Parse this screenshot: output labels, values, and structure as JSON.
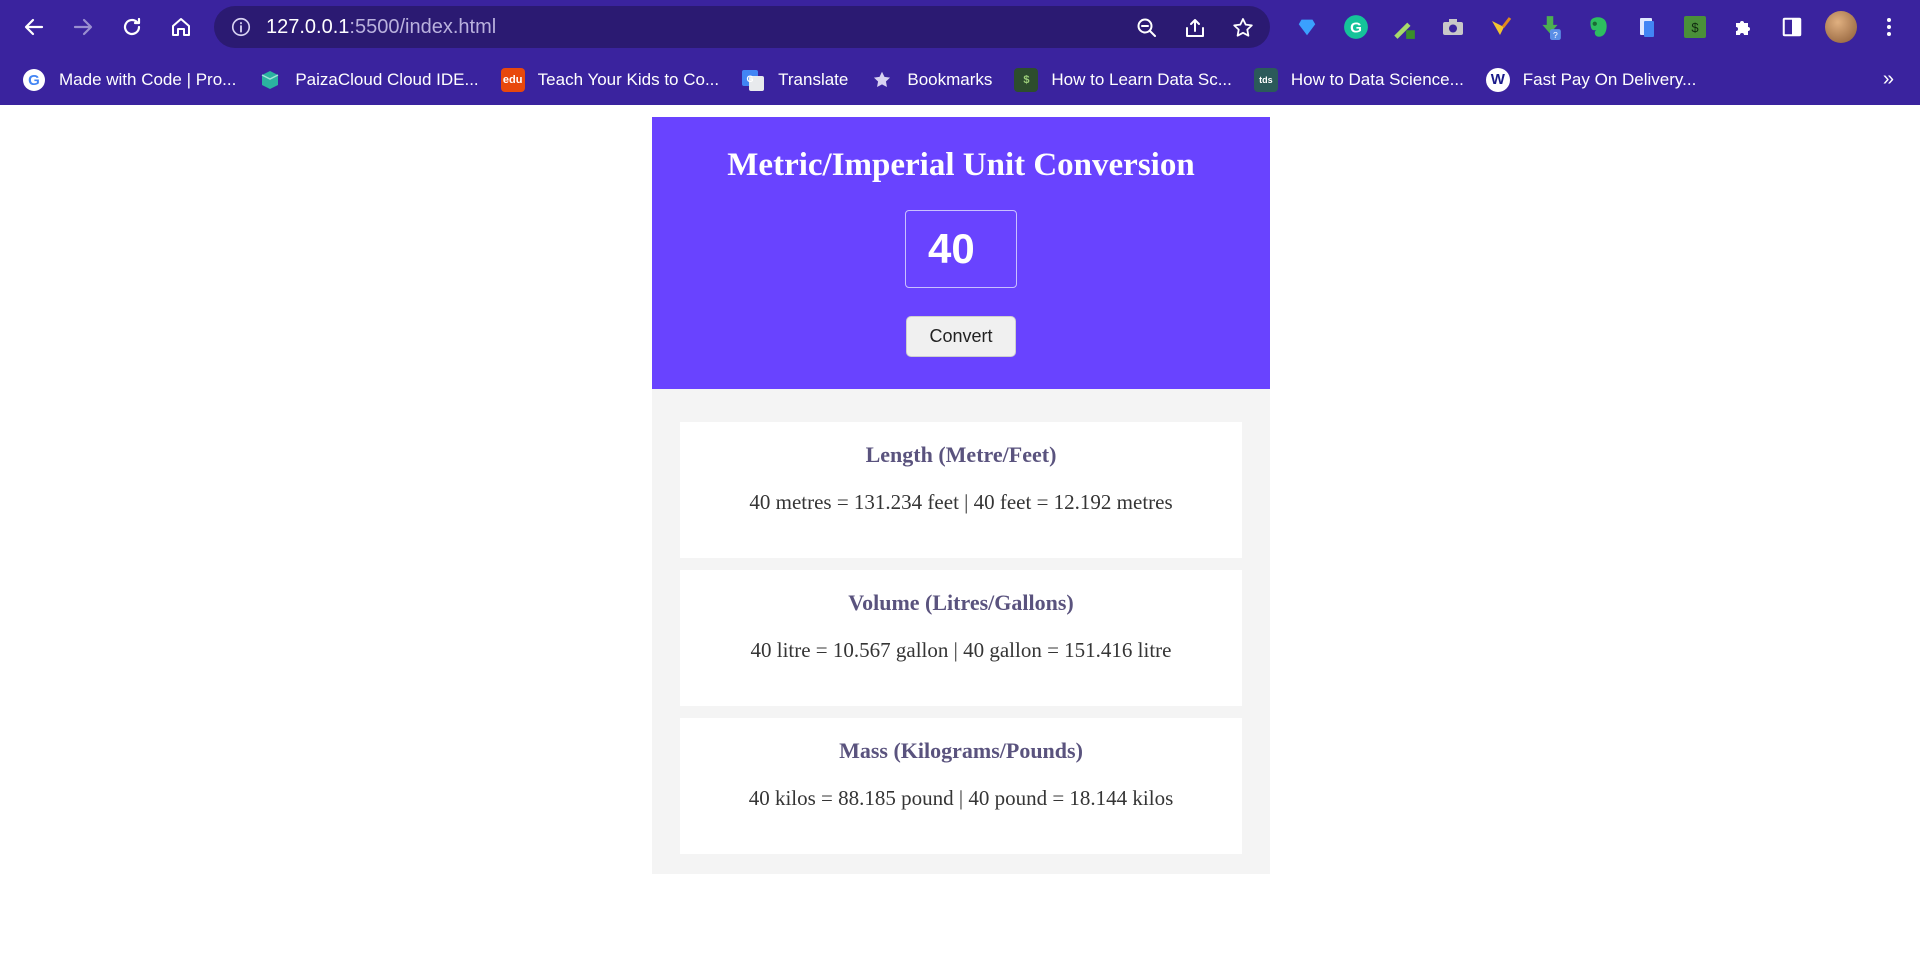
{
  "browser": {
    "url_host": "127.0.0.1",
    "url_path": ":5500/index.html",
    "bookmarks": [
      {
        "label": "Made with Code | Pro...",
        "icon": "google-icon"
      },
      {
        "label": "PaizaCloud Cloud IDE...",
        "icon": "paizacloud-icon"
      },
      {
        "label": "Teach Your Kids to Co...",
        "icon": "edu-icon",
        "badge": "edu"
      },
      {
        "label": "Translate",
        "icon": "translate-icon"
      },
      {
        "label": "Bookmarks",
        "icon": "star-icon"
      },
      {
        "label": "How to Learn Data Sc...",
        "icon": "dollar-icon"
      },
      {
        "label": "How to Data Science...",
        "icon": "tds-icon",
        "badge": "tds"
      },
      {
        "label": "Fast Pay On Delivery...",
        "icon": "w-icon",
        "badge": "W"
      }
    ],
    "more": "»",
    "colors": {
      "chrome": "#3a239e",
      "omnibox": "#2b1a72"
    }
  },
  "app": {
    "title": "Metric/Imperial Unit Conversion",
    "input_value": "40",
    "convert_label": "Convert",
    "colors": {
      "hero": "#6943ff",
      "panel": "#f4f4f4",
      "card_title": "#5a537e"
    },
    "cards": [
      {
        "title": "Length (Metre/Feet)",
        "result": "40 metres = 131.234 feet | 40 feet = 12.192 metres"
      },
      {
        "title": "Volume (Litres/Gallons)",
        "result": "40 litre = 10.567 gallon | 40 gallon = 151.416 litre"
      },
      {
        "title": "Mass (Kilograms/Pounds)",
        "result": "40 kilos = 88.185 pound | 40 pound = 18.144 kilos"
      }
    ]
  }
}
